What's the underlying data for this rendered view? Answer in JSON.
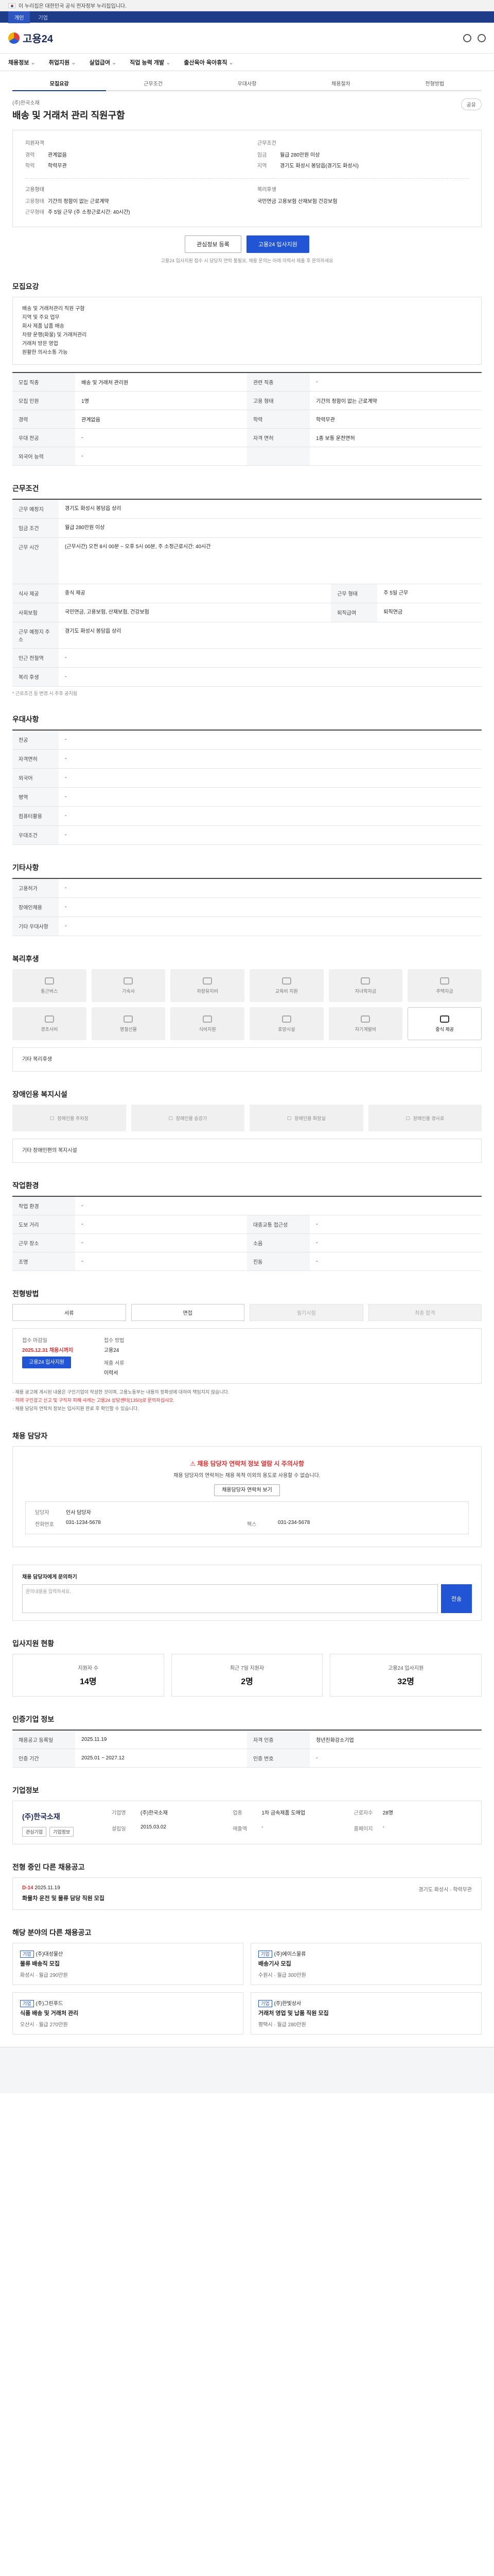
{
  "gov_bar": "이 누리집은 대한민국 공식 전자정부 누리집입니다.",
  "top_tabs": [
    "개인",
    "기업"
  ],
  "brand": "고용24",
  "nav": [
    "채용정보",
    "취업지원",
    "실업급여",
    "직업 능력 개발",
    "출산육아 육아휴직"
  ],
  "sub_tabs": [
    "모집요강",
    "근무조건",
    "우대사항",
    "채용절차",
    "전형방법"
  ],
  "job": {
    "company_small": "(주)한국소재",
    "title": "배송 및 거래처 관리 직원구함",
    "share": "공유"
  },
  "summary": {
    "left_head": "지원자격",
    "left": [
      [
        "경력",
        "관계없음"
      ],
      [
        "학력",
        "학력무관"
      ]
    ],
    "right_head": "근무조건",
    "right": [
      [
        "임금",
        "월급 280만원 이상"
      ],
      [
        "지역",
        "경기도 화성시 봉담읍(경기도 화성시)"
      ]
    ],
    "left2_head": "고용형태",
    "left2": [
      [
        "고용형태",
        "기간의 정함이 없는 근로계약"
      ],
      [
        "근무형태",
        "주 5일 근무 (주 소정근로시간: 40시간)"
      ]
    ],
    "right2_head": "복리후생",
    "right2": [
      [
        "",
        "국민연금 고용보험 산재보험 건강보험"
      ]
    ]
  },
  "buttons": {
    "save": "관심정보 등록",
    "apply": "고용24 입사지원"
  },
  "notice_top": "고용24 입사지원 접수 시 담당자 연락 불필요, 채용 문의는 아래 이력서 제출 후 문의하세요",
  "section_titles": {
    "recruit": "모집요강",
    "work": "근무조건",
    "pref": "우대사항",
    "other_pref": "기타사항",
    "benefit": "복리후생",
    "disabled": "장애인용 복지시설",
    "env": "작업환경",
    "process": "전형방법",
    "manager": "채용 담당자",
    "inquiry": "채용 담당자에게 문의하기",
    "stats": "입사지원 현황",
    "info": "인증기업 정보",
    "company": "기업정보",
    "rec": "전형 중인 다른 채용공고",
    "others": "해당 분야의 다른 채용공고"
  },
  "duties": [
    "배송 및 거래처관리 직원 구함",
    "지역 및 주요 업무",
    "회사 제품 납품 배송",
    "차량 운행(화물) 및 거래처관리",
    "거래처 방문 영업",
    "원활한 의사소통 가능"
  ],
  "recruit_rows": [
    [
      "모집 직종",
      "배송 및 거래처 관리원",
      "관련 직종",
      "-"
    ],
    [
      "모집 인원",
      "1명",
      "고용 형태",
      "기간의 정함이 없는 근로계약"
    ],
    [
      "경력",
      "관계없음",
      "학력",
      "학력무관"
    ],
    [
      "우대 전공",
      "-",
      "자격 면허",
      "1종 보통 운전면허"
    ],
    [
      "외국어 능력",
      "-",
      "",
      ""
    ]
  ],
  "work_rows": [
    [
      "근무 예정지",
      "경기도 화성시 봉담읍 상리"
    ],
    [
      "임금 조건",
      "월급 280만원 이상"
    ],
    [
      "근무 시간",
      "(근무시간) 오전 8시 00분 ~ 오후 5시 00분, 주 소정근로시간: 40시간"
    ],
    [
      "식사 제공",
      "중식 제공",
      "근무 형태",
      "주 5일 근무"
    ],
    [
      "사회보험",
      "국민연금, 고용보험, 산재보험, 건강보험",
      "퇴직급여",
      "퇴직연금"
    ],
    [
      "근무 예정지 주소",
      "경기도 화성시 봉담읍 상리"
    ],
    [
      "인근 전철역",
      "-"
    ],
    [
      "복리 후생",
      "-"
    ]
  ],
  "work_note": "* 근로조건 등 변경 시 추후 공지됨",
  "pref_rows": [
    [
      "전공",
      "-"
    ],
    [
      "자격면허",
      "-"
    ],
    [
      "외국어",
      "-"
    ],
    [
      "병역",
      "-"
    ],
    [
      "컴퓨터활용",
      "-"
    ],
    [
      "우대조건",
      "-"
    ]
  ],
  "other_rows": [
    [
      "고용허가",
      "-"
    ],
    [
      "장애인채용",
      "-"
    ],
    [
      "기타 우대사항",
      "-"
    ]
  ],
  "benefits": [
    "통근버스",
    "기숙사",
    "차량유지비",
    "교육비 지원",
    "자녀학자금",
    "주택자금",
    "경조사비",
    "명절선물",
    "식비지원",
    "휴양시설",
    "자기계발비",
    "중식 제공"
  ],
  "benefit_more": "기타 복리후생",
  "disabled_items": [
    "장애인용 주차장",
    "장애인용 승강기",
    "장애인용 화장실",
    "장애인용 경사로"
  ],
  "disabled_more": "기타 장애인편의 복지시설",
  "env_rows": [
    [
      "작업 환경",
      "-",
      "",
      ""
    ],
    [
      "도보 거리",
      "-",
      "대중교통 접근성",
      "-"
    ],
    [
      "근무 장소",
      "-",
      "소음",
      "-"
    ],
    [
      "조명",
      "-",
      "진동",
      "-"
    ]
  ],
  "process": [
    "서류",
    "면접",
    "필기시험",
    "최종 합격"
  ],
  "apply": {
    "period_label": "접수 마감일",
    "period": "2025.12.31 채용시까지",
    "method_label": "접수 방법",
    "method": "고용24",
    "docs_label": "제출 서류",
    "docs": "이력서",
    "apply_btn": "고용24 입사지원"
  },
  "notices": [
    "· 채용 공고에 게시된 내용은 구인기업이 작성한 것이며, 고용노동부는 내용의 정확성에 대하여 책임지지 않습니다.",
    "· 허위 구인광고 신고 및 구직자 피해 사례는 고용24 상담센터(1350)로 문의하십시오.",
    "· 채용 담당자 연락처 정보는 입사지원 완료 후 확인할 수 있습니다."
  ],
  "manager": {
    "warn": "채용 담당자 연락처 정보 열람 시 주의사항",
    "desc": "채용 담당자의 연락처는 채용 목적 이외의 용도로 사용할 수 없습니다.",
    "btn": "채용담당자 연락처 보기",
    "name_label": "담당자",
    "name": "인사 담당자",
    "phone_label": "전화번호",
    "phone": "031-1234-5678",
    "fax_label": "팩스",
    "fax": "031-234-5678"
  },
  "inquiry_placeholder": "문의내용을 입력하세요.",
  "inquiry_send": "전송",
  "stats": [
    [
      "지원자 수",
      "14명"
    ],
    [
      "최근 7일 지원자",
      "2명"
    ],
    [
      "고용24 입사지원",
      "32명"
    ]
  ],
  "info_rows": [
    [
      "채용공고 등록일",
      "2025.11.19",
      "자격 인증",
      "청년친화강소기업"
    ],
    [
      "인증 기간",
      "2025.01 ~ 2027.12",
      "인증 번호",
      "-"
    ]
  ],
  "company": {
    "logo": "(주)한국소재",
    "rows": [
      [
        "기업명",
        "(주)한국소재"
      ],
      [
        "업종",
        "1차 금속제품 도매업"
      ],
      [
        "근로자수",
        "28명"
      ],
      [
        "설립일",
        "2015.03.02"
      ],
      [
        "매출액",
        "-"
      ],
      [
        "홈페이지",
        "-"
      ]
    ],
    "btns": [
      "관심기업",
      "기업정보"
    ]
  },
  "rec": {
    "tag": "D-14",
    "date": "2025.11.19",
    "title": "화물차 운전 및 물류 담당 직원 모집",
    "meta": "경기도 화성시 · 학력무관"
  },
  "others": [
    {
      "company": "(주)대성물산",
      "title": "물류 배송직 모집",
      "meta": "화성시 · 월급 290만원"
    },
    {
      "company": "(주)에이스물류",
      "title": "배송기사 모집",
      "meta": "수원시 · 월급 300만원"
    },
    {
      "company": "(주)그린푸드",
      "title": "식품 배송 및 거래처 관리",
      "meta": "오산시 · 월급 270만원"
    },
    {
      "company": "(주)한빛상사",
      "title": "거래처 영업 및 납품 직원 모집",
      "meta": "평택시 · 월급 280만원"
    }
  ]
}
